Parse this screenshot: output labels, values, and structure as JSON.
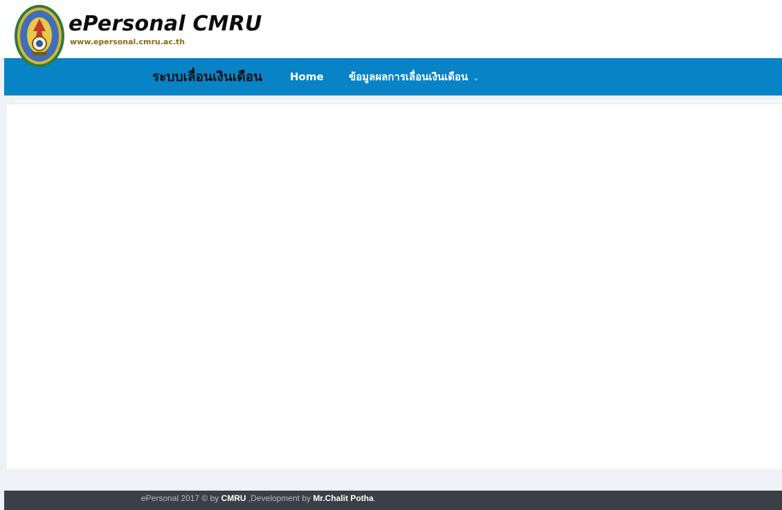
{
  "header": {
    "brand_title": "ePersonal CMRU",
    "brand_url": "www.epersonal.cmru.ac.th",
    "logo_icon": "university-seal-icon"
  },
  "nav": {
    "brand": "ระบบเลื่อนเงินเดือน",
    "items": [
      {
        "label": "Home"
      },
      {
        "label": "ข้อมูลผลการเลื่อนเงินเดือน",
        "has_dropdown": true,
        "dropdown_icon": "chevron-down-icon"
      }
    ]
  },
  "footer": {
    "part1": "ePersonal 2017 © by ",
    "org": "CMRU",
    "part2": " ,Development by ",
    "developer": "Mr.Chalit Potha",
    "part3": "."
  },
  "colors": {
    "nav_bg": "#0783c6",
    "footer_bg": "#3b4047",
    "page_bg": "#eef1f6",
    "url_color": "#8a6a12"
  }
}
